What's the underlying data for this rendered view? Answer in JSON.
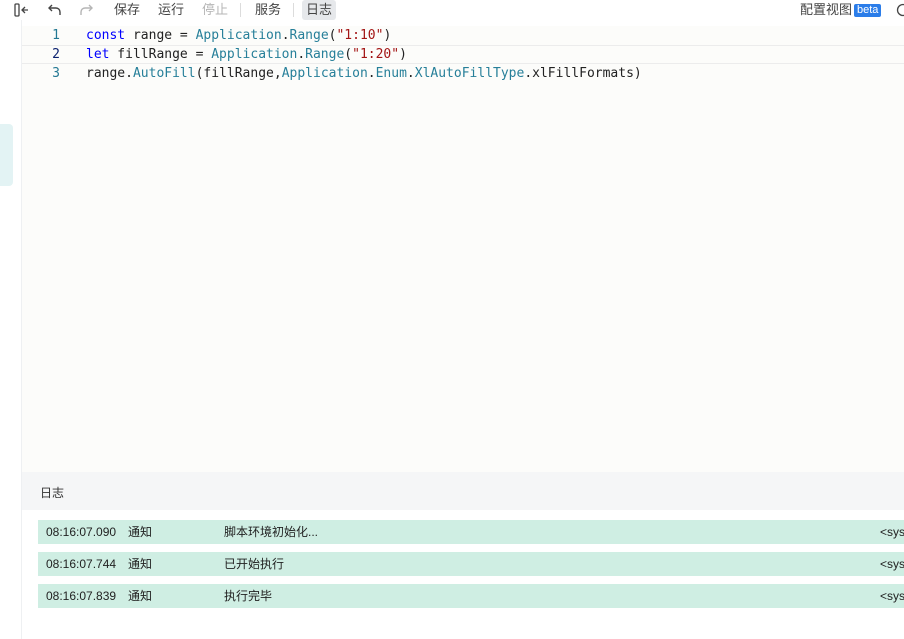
{
  "toolbar": {
    "save_label": "保存",
    "run_label": "运行",
    "stop_label": "停止",
    "service_label": "服务",
    "log_label": "日志",
    "config_view_label": "配置视图",
    "beta_badge": "beta"
  },
  "icons": {
    "sidebar_toggle": "sidebar-collapse-icon",
    "undo": "undo-icon",
    "redo": "redo-icon",
    "info": "info-icon"
  },
  "editor": {
    "current_line": 2,
    "lines": [
      {
        "number": "1",
        "tokens": [
          {
            "t": "const",
            "k": "kw"
          },
          {
            "t": " range = ",
            "k": ""
          },
          {
            "t": "Application",
            "k": "cls"
          },
          {
            "t": ".",
            "k": ""
          },
          {
            "t": "Range",
            "k": "cls"
          },
          {
            "t": "(",
            "k": ""
          },
          {
            "t": "\"1:10\"",
            "k": "str"
          },
          {
            "t": ")",
            "k": ""
          }
        ]
      },
      {
        "number": "2",
        "tokens": [
          {
            "t": "let",
            "k": "kw"
          },
          {
            "t": " fillRange = ",
            "k": ""
          },
          {
            "t": "Application",
            "k": "cls"
          },
          {
            "t": ".",
            "k": ""
          },
          {
            "t": "Range",
            "k": "cls"
          },
          {
            "t": "(",
            "k": ""
          },
          {
            "t": "\"1:20\"",
            "k": "str"
          },
          {
            "t": ")",
            "k": ""
          }
        ]
      },
      {
        "number": "3",
        "tokens": [
          {
            "t": "range.",
            "k": ""
          },
          {
            "t": "AutoFill",
            "k": "cls"
          },
          {
            "t": "(fillRange,",
            "k": ""
          },
          {
            "t": "Application",
            "k": "cls"
          },
          {
            "t": ".",
            "k": ""
          },
          {
            "t": "Enum",
            "k": "cls"
          },
          {
            "t": ".",
            "k": ""
          },
          {
            "t": "XlAutoFillType",
            "k": "cls"
          },
          {
            "t": ".xlFillFormats)",
            "k": ""
          }
        ]
      }
    ]
  },
  "log": {
    "title": "日志",
    "rows": [
      {
        "time": "08:16:07.090",
        "level": "通知",
        "message": "脚本环境初始化...",
        "source": "<sys"
      },
      {
        "time": "08:16:07.744",
        "level": "通知",
        "message": "已开始执行",
        "source": "<sys"
      },
      {
        "time": "08:16:07.839",
        "level": "通知",
        "message": "执行完毕",
        "source": "<sys"
      }
    ]
  },
  "colors": {
    "log_row_bg": "#cfeee3",
    "beta_bg": "#2b7de9",
    "keyword": "#0000ff",
    "class_name": "#267f99",
    "string": "#a31515"
  }
}
